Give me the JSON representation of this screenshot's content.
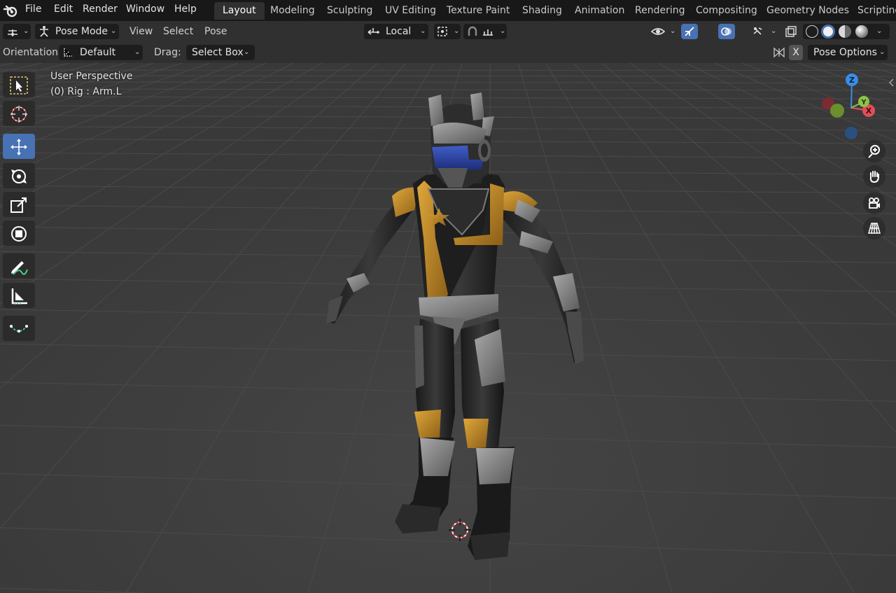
{
  "menu": [
    "File",
    "Edit",
    "Render",
    "Window",
    "Help"
  ],
  "workspaces": [
    "Layout",
    "Modeling",
    "Sculpting",
    "UV Editing",
    "Texture Paint",
    "Shading",
    "Animation",
    "Rendering",
    "Compositing",
    "Geometry Nodes",
    "Scripting"
  ],
  "active_workspace": "Layout",
  "header": {
    "mode": "Pose Mode",
    "view": "View",
    "select": "Select",
    "pose": "Pose",
    "transform_orientation": "Local"
  },
  "tool_settings": {
    "orientation_label": "Orientation:",
    "orientation_value": "Default",
    "drag_label": "Drag:",
    "drag_value": "Select Box",
    "x_toggle": "X",
    "pose_options": "Pose Options"
  },
  "viewport": {
    "view_name": "User Perspective",
    "active_object": "(0) Rig : Arm.L"
  },
  "gizmo": {
    "x": "X",
    "y": "Y",
    "z": "Z"
  },
  "tools": [
    "select-box-tool",
    "cursor-tool",
    "move-tool",
    "rotate-tool",
    "scale-tool",
    "transform-tool",
    "annotate-tool",
    "measure-tool",
    "relax-pose-tool"
  ],
  "active_tool": "move-tool",
  "colors": {
    "accent": "#4772b3",
    "gold": "#c8902a",
    "axis_x": "#e34d5a",
    "axis_y": "#8bc34a",
    "axis_z": "#3a8ee6"
  }
}
